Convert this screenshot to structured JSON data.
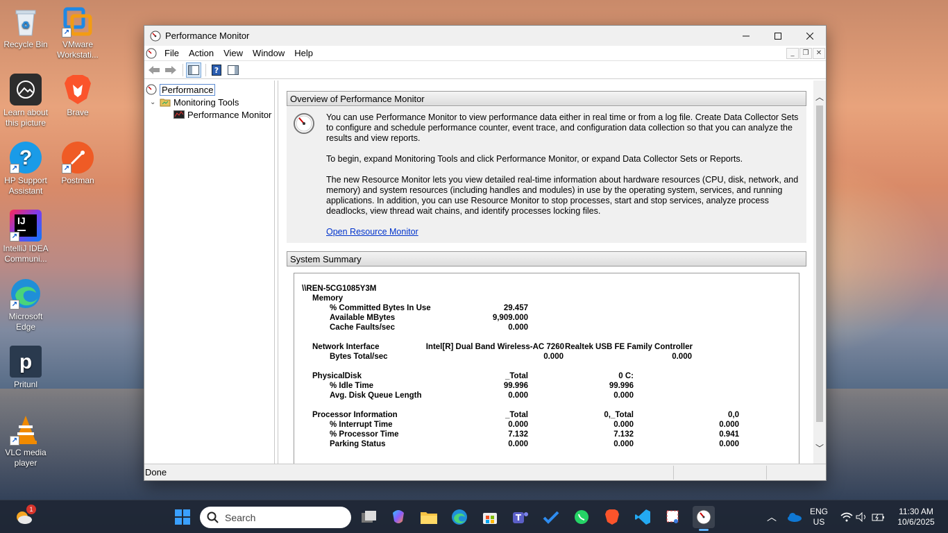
{
  "desktop": {
    "icons": [
      {
        "label": "Recycle Bin"
      },
      {
        "label": "VMware Workstati..."
      },
      {
        "label": "Learn about this picture"
      },
      {
        "label": "Brave"
      },
      {
        "label": "HP Support Assistant"
      },
      {
        "label": "Postman"
      },
      {
        "label": "IntelliJ IDEA Communi..."
      },
      {
        "label": "Microsoft Edge"
      },
      {
        "label": "Pritunl"
      },
      {
        "label": "VLC media player"
      }
    ]
  },
  "window": {
    "title": "Performance Monitor",
    "menu": [
      "File",
      "Action",
      "View",
      "Window",
      "Help"
    ],
    "tree": {
      "root": "Performance",
      "child": "Monitoring Tools",
      "grandchild": "Performance Monitor"
    },
    "overview": {
      "header": "Overview of Performance Monitor",
      "p1": "You can use Performance Monitor to view performance data either in real time or from a log file. Create Data Collector Sets to configure and schedule performance counter, event trace, and configuration data collection so that you can analyze the results and view reports.",
      "p2": "To begin, expand Monitoring Tools and click Performance Monitor, or expand Data Collector Sets or Reports.",
      "p3": "The new Resource Monitor lets you view detailed real-time information about hardware resources (CPU, disk, network, and memory) and system resources (including handles and modules) in use by the operating system, services, and running applications. In addition, you can use Resource Monitor to stop processes, start and stop services, analyze process deadlocks, view thread wait chains, and identify processes locking files.",
      "link": "Open Resource Monitor"
    },
    "summary": {
      "header": "System Summary",
      "machine": "\\\\REN-5CG1085Y3M",
      "memory": {
        "title": "Memory",
        "rows": [
          {
            "label": "% Committed Bytes In Use",
            "v1": "29.457"
          },
          {
            "label": "Available MBytes",
            "v1": "9,909.000"
          },
          {
            "label": "Cache Faults/sec",
            "v1": "0.000"
          }
        ]
      },
      "network": {
        "title": "Network Interface",
        "col1": "Intel[R] Dual Band Wireless-AC 7260",
        "col2": "Realtek USB FE Family Controller",
        "row_label": "Bytes Total/sec",
        "v1": "0.000",
        "v2": "0.000"
      },
      "disk": {
        "title": "PhysicalDisk",
        "col1": "_Total",
        "col2": "0 C:",
        "rows": [
          {
            "label": "% Idle Time",
            "v1": "99.996",
            "v2": "99.996"
          },
          {
            "label": "Avg. Disk Queue Length",
            "v1": "0.000",
            "v2": "0.000"
          }
        ]
      },
      "processor": {
        "title": "Processor Information",
        "col1": "_Total",
        "col2": "0,_Total",
        "col3": "0,0",
        "rows": [
          {
            "label": "% Interrupt Time",
            "v1": "0.000",
            "v2": "0.000",
            "v3": "0.000"
          },
          {
            "label": "% Processor Time",
            "v1": "7.132",
            "v2": "7.132",
            "v3": "0.941"
          },
          {
            "label": "Parking Status",
            "v1": "0.000",
            "v2": "0.000",
            "v3": "0.000"
          }
        ]
      }
    },
    "status": "Done"
  },
  "taskbar": {
    "search_placeholder": "Search",
    "weather_badge": "1",
    "lang1": "ENG",
    "lang2": "US",
    "time": "11:30 AM",
    "date": "10/6/2025"
  },
  "colors": {
    "link": "#0033cc",
    "selection": "#5a8ad0",
    "taskbar": "#1e2634"
  }
}
